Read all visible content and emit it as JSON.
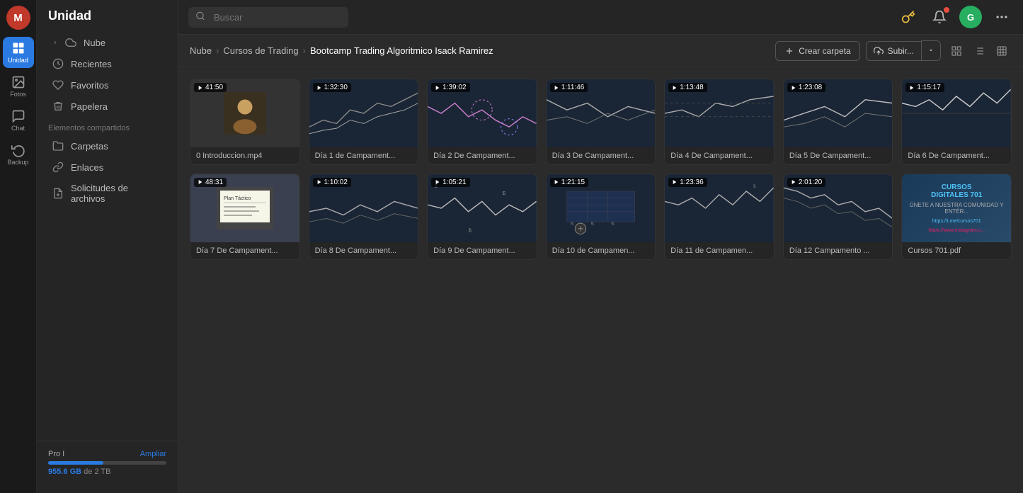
{
  "app": {
    "title": "Unidad"
  },
  "iconBar": {
    "avatarLabel": "M",
    "items": [
      {
        "id": "unidad",
        "label": "Unidad",
        "active": true
      },
      {
        "id": "fotos",
        "label": "Fotos",
        "active": false
      },
      {
        "id": "chat",
        "label": "Chat",
        "active": false
      },
      {
        "id": "backup",
        "label": "Backup",
        "active": false
      }
    ]
  },
  "sidebar": {
    "title": "Unidad",
    "nav": [
      {
        "id": "nube",
        "label": "Nube",
        "hasChevron": true
      },
      {
        "id": "recientes",
        "label": "Recientes"
      },
      {
        "id": "favoritos",
        "label": "Favoritos"
      },
      {
        "id": "papelera",
        "label": "Papelera"
      }
    ],
    "sharedLabel": "Elementos compartidos",
    "shared": [
      {
        "id": "carpetas",
        "label": "Carpetas"
      },
      {
        "id": "enlaces",
        "label": "Enlaces"
      },
      {
        "id": "solicitudes",
        "label": "Solicitudes de archivos"
      }
    ],
    "storage": {
      "planLabel": "Pro I",
      "upgradeLinkLabel": "Ampliar",
      "used": "955.6 GB",
      "total": "2 TB",
      "percentFill": 47
    }
  },
  "topbar": {
    "searchPlaceholder": "Buscar"
  },
  "actionBar": {
    "breadcrumbs": [
      {
        "label": "Nube"
      },
      {
        "label": "Cursos de Trading"
      },
      {
        "label": "Bootcamp Trading Algoritmico Isack Ramirez"
      }
    ],
    "createFolderLabel": "Crear carpeta",
    "uploadLabel": "Subir...",
    "viewIcons": [
      "grid",
      "list",
      "tiles"
    ]
  },
  "files": [
    {
      "id": "intro",
      "name": "0 Introduccion.mp4",
      "duration": "41:50",
      "type": "video-person"
    },
    {
      "id": "dia1",
      "name": "Día 1 de Campament...",
      "duration": "1:32:30",
      "type": "video-chart"
    },
    {
      "id": "dia2",
      "name": "Día 2 De Campament...",
      "duration": "1:39:02",
      "type": "video-chart"
    },
    {
      "id": "dia3",
      "name": "Día 3 De Campament...",
      "duration": "1:11:46",
      "type": "video-chart"
    },
    {
      "id": "dia4",
      "name": "Día 4 De Campament...",
      "duration": "1:13:48",
      "type": "video-chart"
    },
    {
      "id": "dia5",
      "name": "Día 5 De Campament...",
      "duration": "1:23:08",
      "type": "video-chart"
    },
    {
      "id": "dia6",
      "name": "Día 6 De Campament...",
      "duration": "1:15:17",
      "type": "video-chart"
    },
    {
      "id": "dia7",
      "name": "Día 7 De Campament...",
      "duration": "48:31",
      "type": "video-whiteboard"
    },
    {
      "id": "dia8",
      "name": "Día 8 De Campament...",
      "duration": "1:10:02",
      "type": "video-chart"
    },
    {
      "id": "dia9",
      "name": "Día 9 De Campament...",
      "duration": "1:05:21",
      "type": "video-chart"
    },
    {
      "id": "dia10",
      "name": "Día 10 de Campamen...",
      "duration": "1:21:15",
      "type": "video-chart-table"
    },
    {
      "id": "dia11",
      "name": "Día 11 de Campamen...",
      "duration": "1:23:36",
      "type": "video-chart"
    },
    {
      "id": "dia12",
      "name": "Día 12 Campamento ...",
      "duration": "2:01:20",
      "type": "video-chart"
    },
    {
      "id": "cursos701",
      "name": "Cursos 701.pdf",
      "duration": null,
      "type": "pdf"
    }
  ]
}
